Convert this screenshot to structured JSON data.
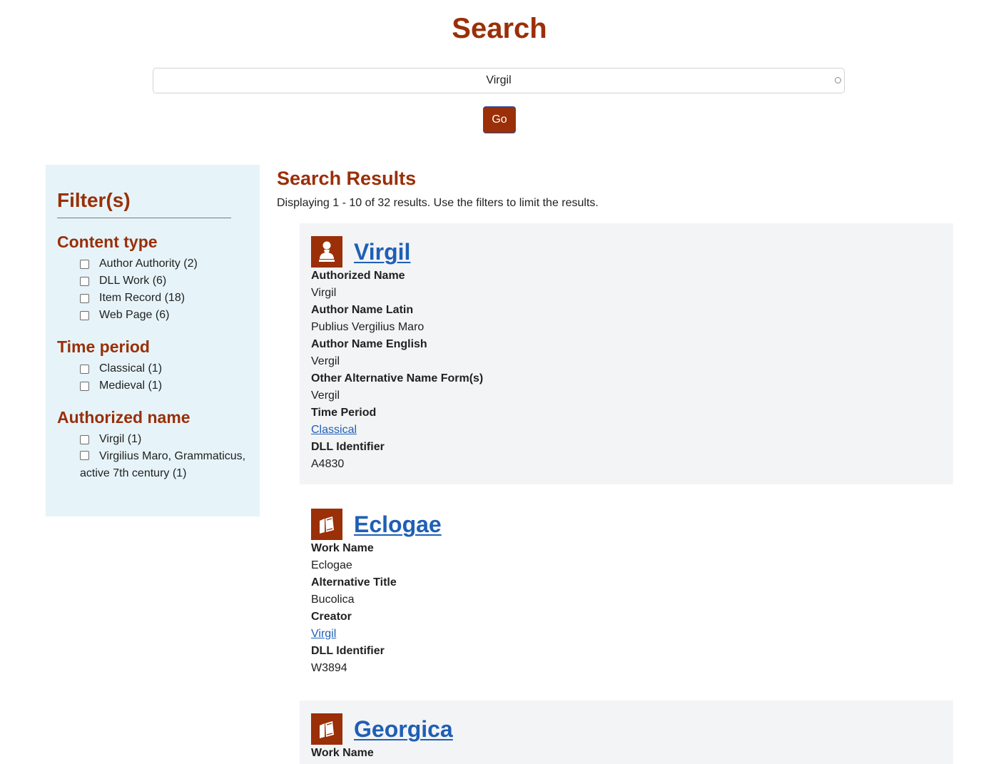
{
  "header": {
    "title": "Search"
  },
  "search": {
    "value": "Virgil",
    "button_label": "Go"
  },
  "filters": {
    "heading": "Filter(s)",
    "facets": [
      {
        "title": "Content type",
        "options": [
          "Author Authority (2)",
          "DLL Work (6)",
          "Item Record (18)",
          "Web Page (6)"
        ]
      },
      {
        "title": "Time period",
        "options": [
          "Classical (1)",
          "Medieval (1)"
        ]
      },
      {
        "title": "Authorized name",
        "options": [
          "Virgil (1)",
          "Virgilius Maro, Grammaticus, active 7th century (1)"
        ]
      }
    ]
  },
  "results": {
    "heading": "Search Results",
    "summary": "Displaying 1 - 10 of 32 results. Use the filters to limit the results.",
    "items": [
      {
        "icon": "bust-icon",
        "title": "Virgil",
        "fields": [
          {
            "label": "Authorized Name",
            "value": "Virgil"
          },
          {
            "label": "Author Name Latin",
            "value": "Publius Vergilius Maro"
          },
          {
            "label": "Author Name English",
            "value": "Vergil"
          },
          {
            "label": "Other Alternative Name Form(s)",
            "value": "Vergil"
          },
          {
            "label": "Time Period",
            "value": "Classical"
          },
          {
            "label": "DLL Identifier",
            "value": "A4830"
          }
        ]
      },
      {
        "icon": "books-icon",
        "title": "Eclogae",
        "fields": [
          {
            "label": "Work Name",
            "value": "Eclogae"
          },
          {
            "label": "Alternative Title",
            "value": "Bucolica"
          },
          {
            "label": "Creator",
            "value": "Virgil"
          },
          {
            "label": "DLL Identifier",
            "value": "W3894"
          }
        ]
      },
      {
        "icon": "books-icon",
        "title": "Georgica",
        "fields": [
          {
            "label": "Work Name",
            "value": ""
          }
        ]
      }
    ]
  },
  "colors": {
    "accent": "#9a2f08",
    "link": "#1f5fb5",
    "sidebar_bg": "#e6f4f9",
    "card_bg": "#f3f4f6"
  }
}
